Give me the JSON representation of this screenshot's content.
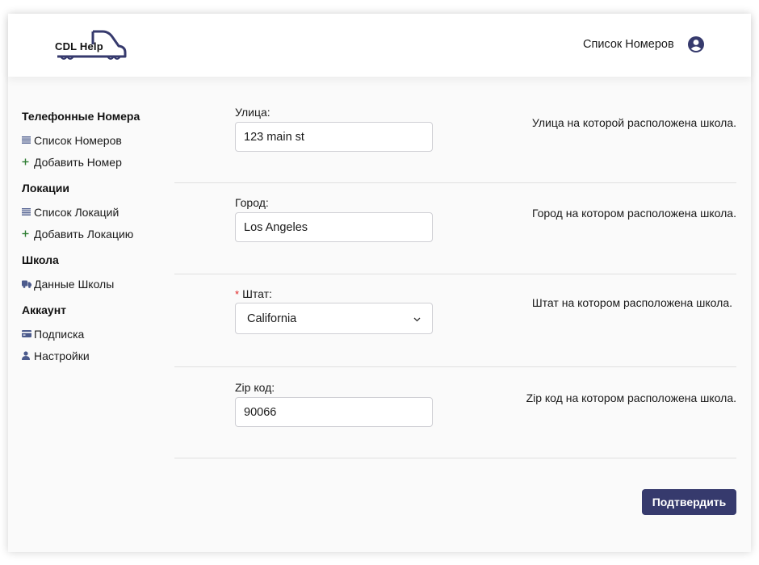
{
  "brand": {
    "name": "CDL Help",
    "accent": "#363a6d"
  },
  "header": {
    "nav_link": "Список Номеров",
    "user_icon": "user-circle-icon"
  },
  "sidebar": {
    "groups": [
      {
        "heading": "Телефонные Номера",
        "items": [
          {
            "label": "Список Номеров",
            "icon": "list-icon"
          },
          {
            "label": "Добавить Номер",
            "icon": "plus-icon"
          }
        ]
      },
      {
        "heading": "Локации",
        "items": [
          {
            "label": "Список Локаций",
            "icon": "list-icon"
          },
          {
            "label": "Добавить Локацию",
            "icon": "plus-icon"
          }
        ]
      },
      {
        "heading": "Школа",
        "items": [
          {
            "label": "Данные Школы",
            "icon": "truck-icon"
          }
        ]
      },
      {
        "heading": "Аккаунт",
        "items": [
          {
            "label": "Подписка",
            "icon": "credit-card-icon"
          },
          {
            "label": "Настройки",
            "icon": "user-icon"
          }
        ]
      }
    ]
  },
  "form": {
    "fields": [
      {
        "label": "Улица:",
        "value": "123 main st",
        "help": "Улица на которой расположена школа.",
        "required": false
      },
      {
        "label": "Город:",
        "value": "Los Angeles",
        "help": "Город на котором расположена школа.",
        "required": false
      },
      {
        "label": "Штат:",
        "value": "California",
        "help": "Штат на котором расположена школа.",
        "required": true,
        "required_mark": "*"
      },
      {
        "label": "Zip код:",
        "value": "90066",
        "help": "Zip код на котором расположена школа.",
        "required": false
      }
    ],
    "submit_label": "Подтвердить"
  }
}
